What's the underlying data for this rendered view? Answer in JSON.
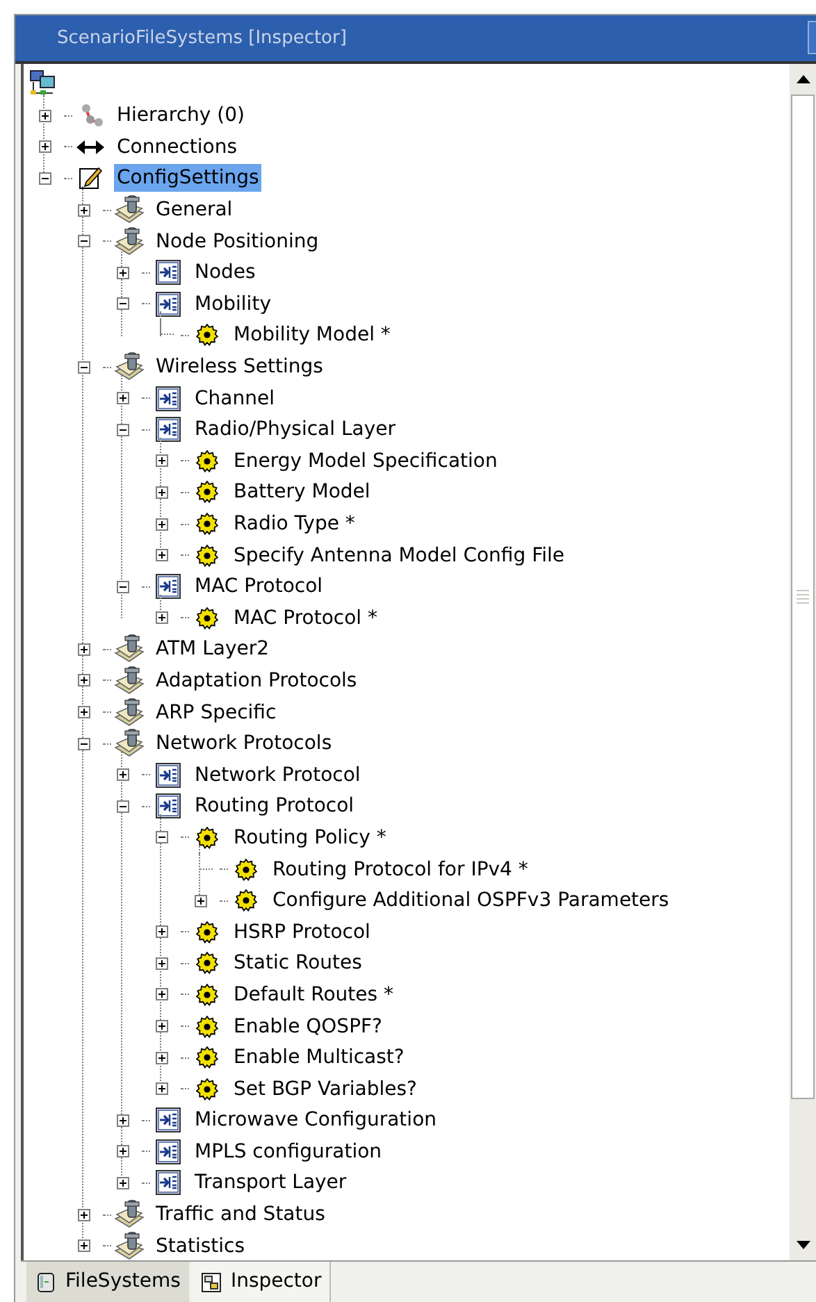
{
  "window": {
    "title": "ScenarioFileSystems [Inspector]"
  },
  "tree": [
    {
      "label": "Hierarchy (0)",
      "kind": "hierarchy",
      "expanded": false,
      "selected": false
    },
    {
      "label": "Connections",
      "kind": "connections",
      "expanded": false,
      "selected": false
    },
    {
      "label": "ConfigSettings",
      "kind": "config",
      "expanded": true,
      "selected": true,
      "children": [
        {
          "label": "General",
          "kind": "section",
          "expanded": false,
          "selected": false
        },
        {
          "label": "Node Positioning",
          "kind": "section",
          "expanded": true,
          "selected": false,
          "children": [
            {
              "label": "Nodes",
              "kind": "page",
              "expanded": false,
              "selected": false
            },
            {
              "label": "Mobility",
              "kind": "page",
              "expanded": true,
              "selected": false,
              "children": [
                {
                  "label": "Mobility Model *",
                  "kind": "gear",
                  "selected": false
                }
              ]
            }
          ]
        },
        {
          "label": "Wireless Settings",
          "kind": "section",
          "expanded": true,
          "selected": false,
          "children": [
            {
              "label": "Channel",
              "kind": "page",
              "expanded": false,
              "selected": false
            },
            {
              "label": "Radio/Physical Layer",
              "kind": "page",
              "expanded": true,
              "selected": false,
              "children": [
                {
                  "label": "Energy Model Specification",
                  "kind": "gear",
                  "expanded": false,
                  "selected": false
                },
                {
                  "label": "Battery Model",
                  "kind": "gear",
                  "expanded": false,
                  "selected": false
                },
                {
                  "label": "Radio Type *",
                  "kind": "gear",
                  "expanded": false,
                  "selected": false
                },
                {
                  "label": "Specify Antenna Model Config File",
                  "kind": "gear",
                  "expanded": false,
                  "selected": false
                }
              ]
            },
            {
              "label": "MAC Protocol",
              "kind": "page",
              "expanded": true,
              "selected": false,
              "children": [
                {
                  "label": "MAC Protocol *",
                  "kind": "gear",
                  "expanded": false,
                  "selected": false
                }
              ]
            }
          ]
        },
        {
          "label": "ATM Layer2",
          "kind": "section",
          "expanded": false,
          "selected": false
        },
        {
          "label": "Adaptation Protocols",
          "kind": "section",
          "expanded": false,
          "selected": false
        },
        {
          "label": "ARP Specific",
          "kind": "section",
          "expanded": false,
          "selected": false
        },
        {
          "label": "Network Protocols",
          "kind": "section",
          "expanded": true,
          "selected": false,
          "children": [
            {
              "label": "Network Protocol",
              "kind": "page",
              "expanded": false,
              "selected": false
            },
            {
              "label": "Routing Protocol",
              "kind": "page",
              "expanded": true,
              "selected": false,
              "children": [
                {
                  "label": "Routing Policy *",
                  "kind": "gear",
                  "expanded": true,
                  "selected": false,
                  "children": [
                    {
                      "label": "Routing Protocol for IPv4 *",
                      "kind": "gear",
                      "selected": false
                    },
                    {
                      "label": "Configure Additional OSPFv3 Parameters",
                      "kind": "gear",
                      "expanded": false,
                      "selected": false
                    }
                  ]
                },
                {
                  "label": "HSRP Protocol",
                  "kind": "gear",
                  "expanded": false,
                  "selected": false
                },
                {
                  "label": "Static Routes",
                  "kind": "gear",
                  "expanded": false,
                  "selected": false
                },
                {
                  "label": "Default Routes *",
                  "kind": "gear",
                  "expanded": false,
                  "selected": false
                },
                {
                  "label": "Enable QOSPF?",
                  "kind": "gear",
                  "expanded": false,
                  "selected": false
                },
                {
                  "label": "Enable Multicast?",
                  "kind": "gear",
                  "expanded": false,
                  "selected": false
                },
                {
                  "label": "Set BGP Variables?",
                  "kind": "gear",
                  "expanded": false,
                  "selected": false
                }
              ]
            },
            {
              "label": "Microwave Configuration",
              "kind": "page",
              "expanded": false,
              "selected": false
            },
            {
              "label": "MPLS configuration",
              "kind": "page",
              "expanded": false,
              "selected": false
            },
            {
              "label": "Transport Layer",
              "kind": "page",
              "expanded": false,
              "selected": false
            }
          ]
        },
        {
          "label": "Traffic and Status",
          "kind": "section",
          "expanded": false,
          "selected": false
        },
        {
          "label": "Statistics",
          "kind": "section",
          "expanded": false,
          "selected": false
        }
      ]
    }
  ],
  "tabs": [
    {
      "label": "FileSystems",
      "kind": "disk",
      "selected": true
    },
    {
      "label": "Inspector",
      "kind": "inspector",
      "selected": false
    }
  ]
}
